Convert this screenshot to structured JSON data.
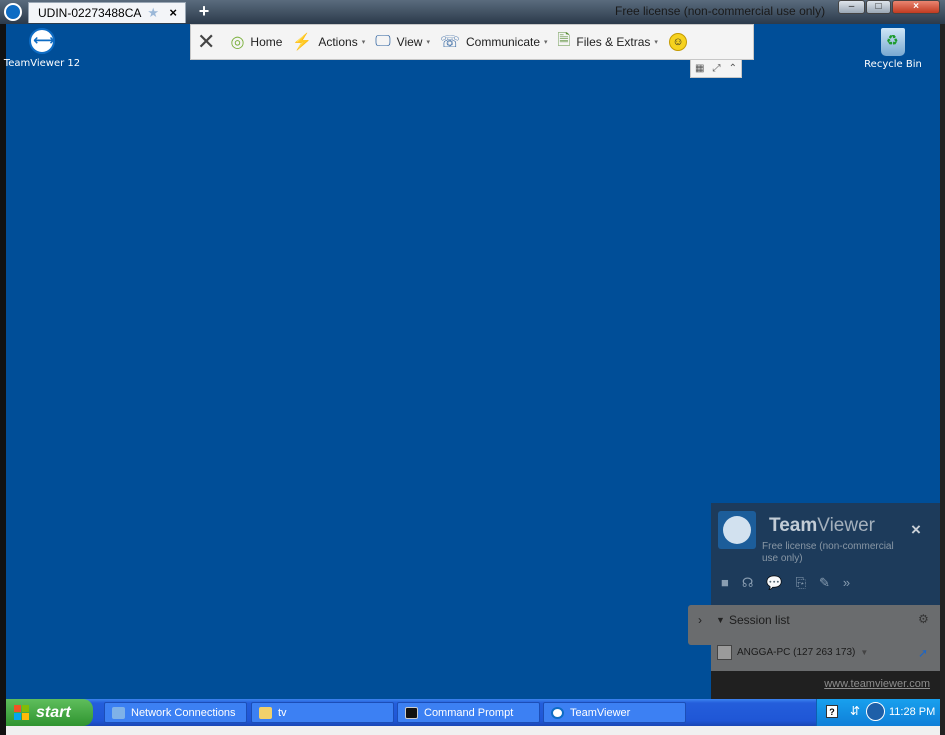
{
  "window": {
    "tab_title": "UDIN-02273488CA",
    "tab_close": "×",
    "new_tab": "+",
    "license_text": "Free license (non-commercial use only)",
    "minimize": "‒",
    "maximize": "□",
    "close": "×"
  },
  "toolbar": {
    "close_glyph": "✕",
    "home": "Home",
    "actions": "Actions",
    "view": "View",
    "communicate": "Communicate",
    "files_extras": "Files & Extras",
    "smiley": "☺",
    "caret": "▾",
    "mini": [
      "▦",
      "⤢",
      "⌃"
    ]
  },
  "desktop": {
    "icons": [
      {
        "label": "TeamViewer 12"
      },
      {
        "label": "Recycle Bin"
      }
    ],
    "background_color": "#004e98"
  },
  "tv_panel": {
    "brand_team": "Team",
    "brand_viewer": "Viewer",
    "free_license": "Free license (non-commercial use only)",
    "close": "×",
    "tools": [
      "■",
      "☊",
      "💬",
      "⎘",
      "✎",
      "»"
    ],
    "session_list_title": "Session list",
    "session_item": "ANGGA-PC (127 263 173)",
    "website": "www.teamviewer.com",
    "handle": "›"
  },
  "taskbar": {
    "start_label": "start",
    "tasks": [
      {
        "label": "Network Connections"
      },
      {
        "label": "tv"
      },
      {
        "label": "Command Prompt"
      },
      {
        "label": "TeamViewer"
      }
    ],
    "tray_help": "?",
    "clock": "11:28 PM"
  }
}
